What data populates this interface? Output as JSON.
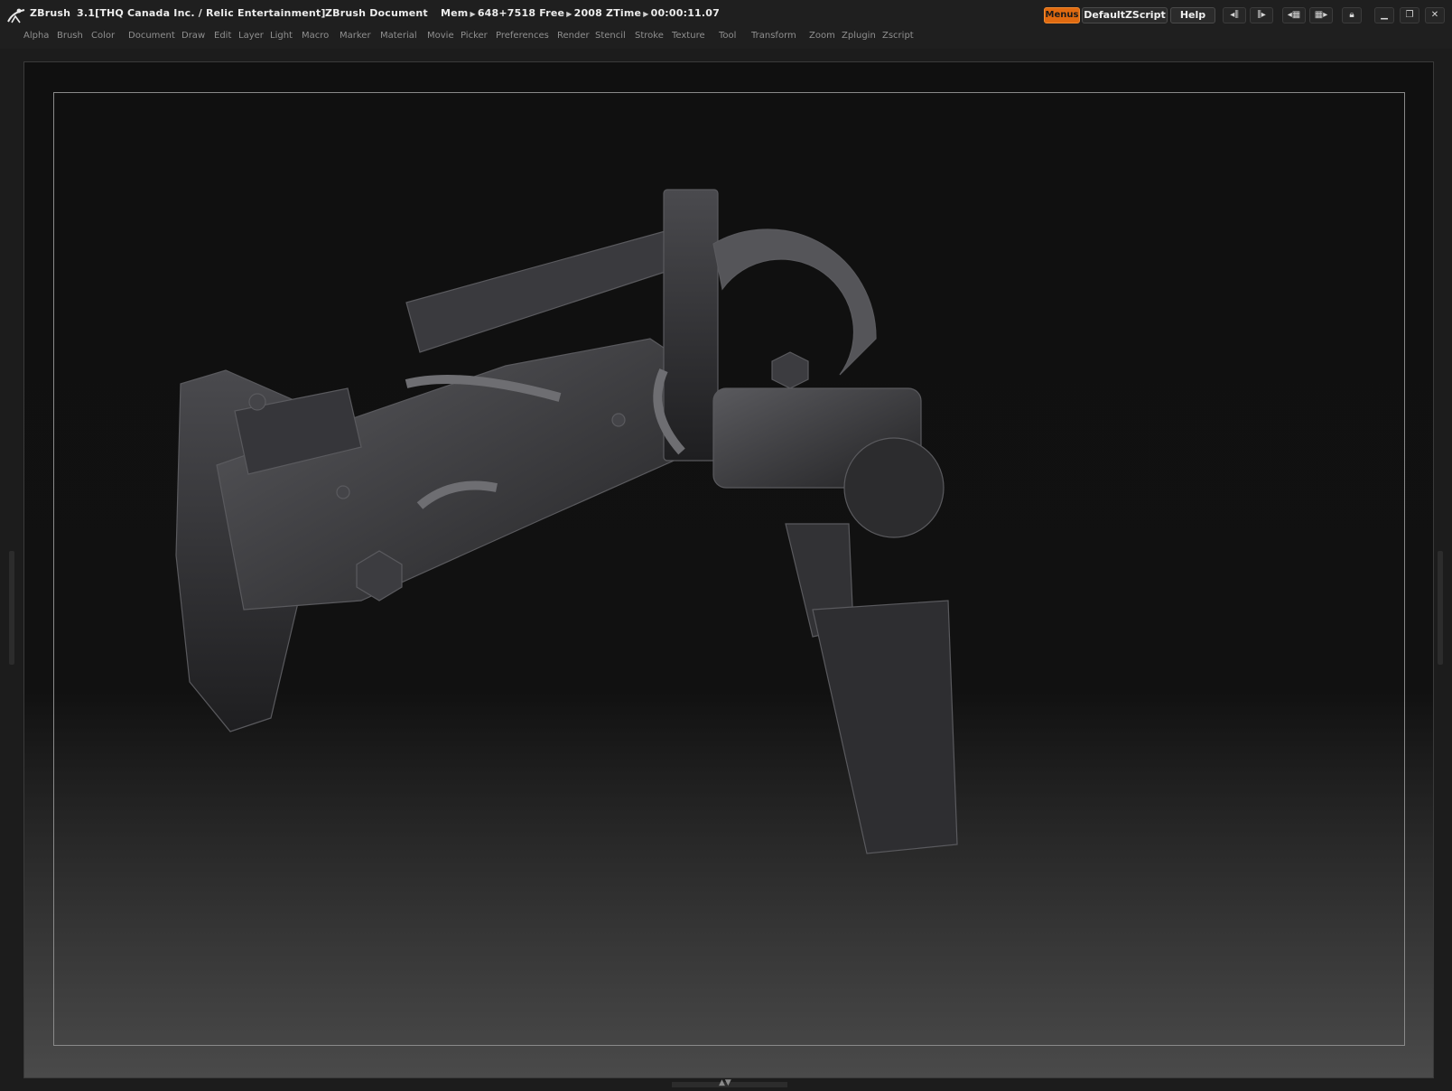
{
  "titlebar": {
    "app_name": "ZBrush",
    "version_info": "3.1[THQ Canada Inc. / Relic Entertainment]",
    "document": "ZBrush Document",
    "mem_label": "Mem",
    "mem_value": "648+7518",
    "free_label": "Free",
    "free_value": "2008",
    "ztime_label": "ZTime",
    "ztime_value": "00:00:11.07",
    "menus_button": "Menus",
    "script_button": "DefaultZScript",
    "help_button": "Help"
  },
  "menubar": {
    "items": [
      "Alpha",
      "Brush",
      "Color",
      "Document",
      "Draw",
      "Edit",
      "Layer",
      "Light",
      "Macro",
      "Marker",
      "Material",
      "Movie",
      "Picker",
      "Preferences",
      "Render",
      "Stencil",
      "Stroke",
      "Texture",
      "Tool",
      "Transform",
      "Zoom",
      "Zplugin",
      "Zscript"
    ]
  },
  "icons": {
    "logo": "zbrush-logo-icon",
    "window_controls": [
      "minimize-icon",
      "restore-icon",
      "close-icon"
    ]
  },
  "colors": {
    "accent": "#e06a10",
    "canvas_top": "#101010",
    "canvas_bottom": "#4a4a4a"
  }
}
